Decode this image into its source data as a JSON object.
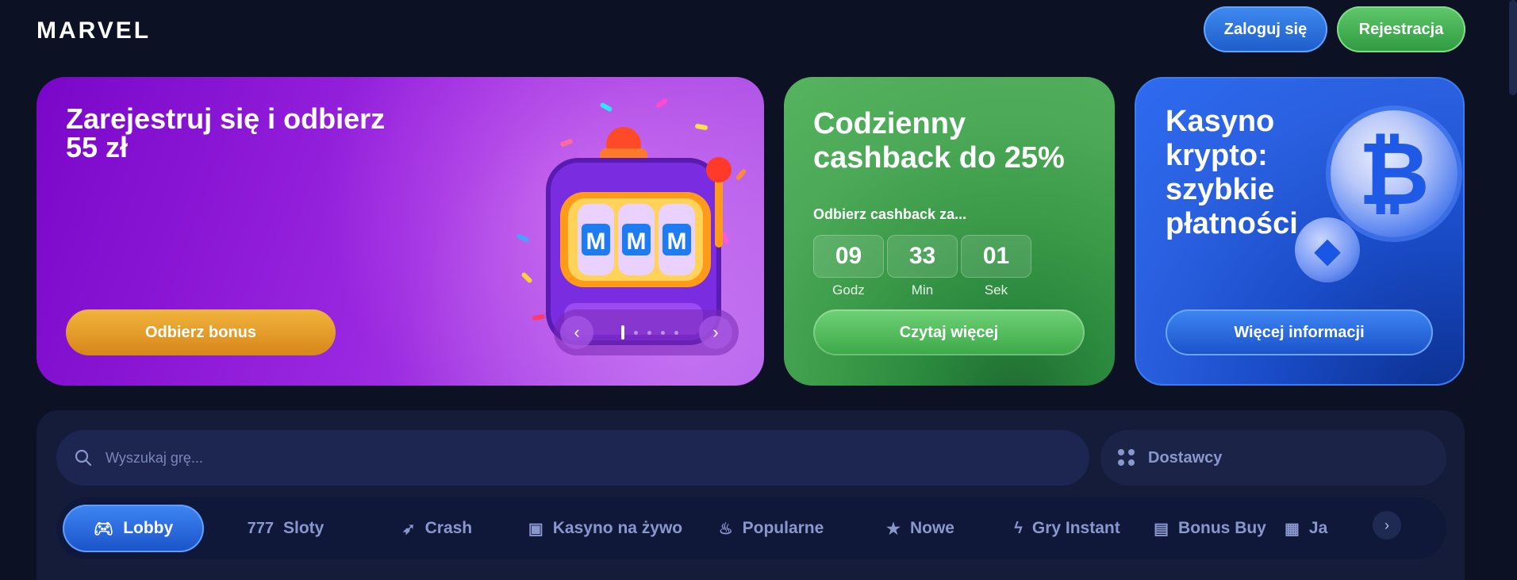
{
  "header": {
    "logo": "MARVEL",
    "login_label": "Zaloguj się",
    "register_label": "Rejestracja"
  },
  "banners": {
    "welcome": {
      "title": "Zarejestruj się i odbierz 55 zł",
      "button": "Odbierz bonus",
      "slot_letters": [
        "M",
        "M",
        "M"
      ],
      "carousel": {
        "prev_icon": "chevron-left-icon",
        "next_icon": "chevron-right-icon",
        "active_index": 1,
        "dot_count": 5
      }
    },
    "cashback": {
      "title": "Codzienny cashback do 25%",
      "subtitle": "Odbierz cashback za...",
      "timer": [
        {
          "value": "09",
          "label": "Godz"
        },
        {
          "value": "33",
          "label": "Min"
        },
        {
          "value": "01",
          "label": "Sek"
        }
      ],
      "button": "Czytaj więcej"
    },
    "crypto": {
      "title": "Kasyno krypto: szybkie płatności",
      "button": "Więcej informacji"
    }
  },
  "games": {
    "search": {
      "placeholder": "Wyszukaj grę..."
    },
    "providers_label": "Dostawcy",
    "tabs": [
      {
        "label": "Lobby",
        "icon": "gamepad-icon",
        "active": true
      },
      {
        "label": "Sloty",
        "icon": "sevens-icon"
      },
      {
        "label": "Crash",
        "icon": "rocket-icon"
      },
      {
        "label": "Kasyno na żywo",
        "icon": "cards-icon"
      },
      {
        "label": "Popularne",
        "icon": "flame-icon"
      },
      {
        "label": "Nowe",
        "icon": "star-icon"
      },
      {
        "label": "Gry Instant",
        "icon": "lightning-icon"
      },
      {
        "label": "Bonus Buy",
        "icon": "ticket-icon"
      },
      {
        "label": "Ja",
        "icon": "jackpot-icon"
      }
    ]
  },
  "colors": {
    "background": "#0d1124",
    "accent_blue": "#2f6fe6",
    "accent_green": "#3ca848",
    "accent_orange": "#e19a28",
    "purple": "#8a1fd6"
  }
}
